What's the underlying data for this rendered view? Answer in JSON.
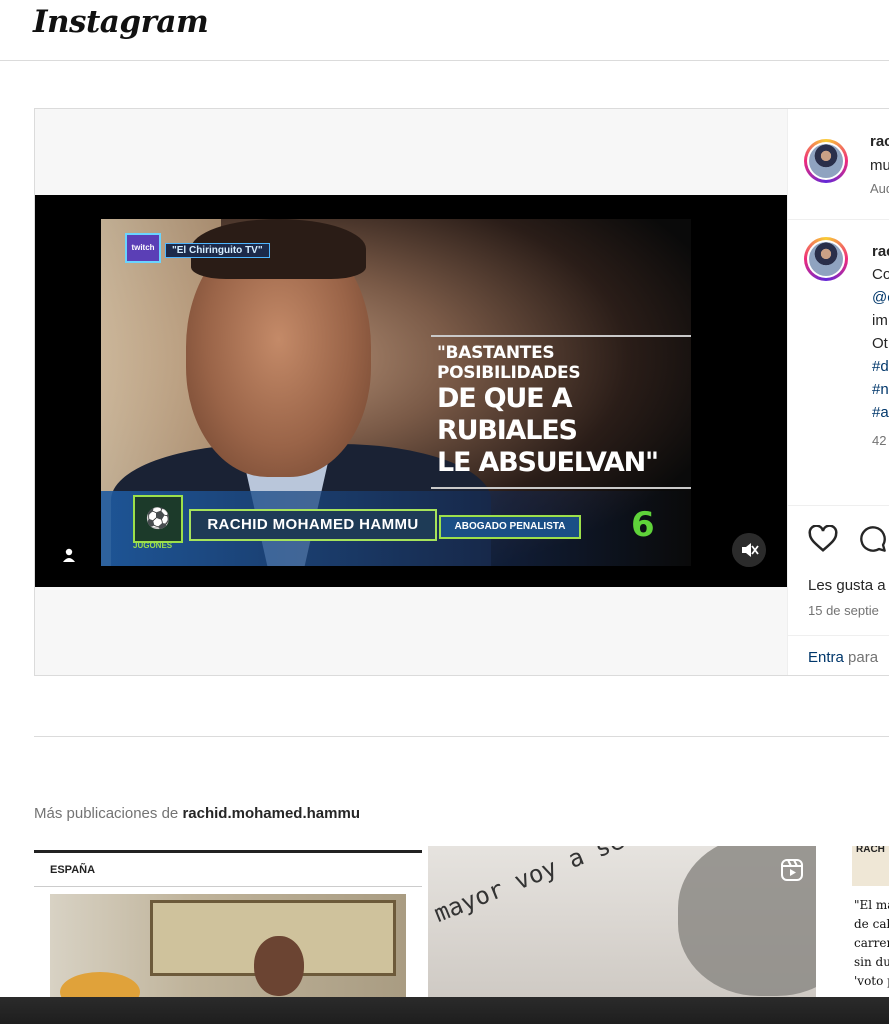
{
  "header": {
    "logo_text": "Instagram"
  },
  "post": {
    "video": {
      "source_tag": "\"El Chiringuito TV\"",
      "live_badge": "twitch",
      "quote_line1": "\"BASTANTES POSIBILIDADES",
      "quote_line2": "DE QUE A RUBIALES",
      "quote_line3": "LE ABSUELVAN\"",
      "channel_name": "JUGONES",
      "name_plate": "RACHID MOHAMED HAMMU",
      "role_plate": "ABOGADO PENALISTA",
      "network_logo": "6"
    },
    "sidebar": {
      "author_line1": "rac",
      "author_line2": "mu",
      "audio_label": "Aud",
      "caption_user": "rac",
      "caption_lines": [
        "Co",
        "@c",
        "im",
        "Ot"
      ],
      "hashtags": [
        "#d",
        "#n",
        "#a"
      ],
      "caption_meta": "42",
      "likes_text": "Les gusta a",
      "date_text": "15 de septie",
      "login_link": "Entra",
      "login_suffix": "para"
    }
  },
  "more": {
    "prefix": "Más publicaciones de",
    "username": "rachid.mohamed.hammu",
    "thumb1_section": "ESPAÑA",
    "thumb2_text": "mayor voy a ser",
    "thumb3_header": "RACH",
    "thumb3_lines": [
      "\"El ma",
      "de cab",
      "carrera",
      "sin dud",
      "'voto p"
    ]
  },
  "icons": {
    "like": "heart-icon",
    "comment": "comment-icon",
    "mute": "muted-speaker-icon",
    "user": "user-tag-icon",
    "reel": "reels-icon"
  },
  "colors": {
    "link": "#00376b",
    "muted": "#737373",
    "border": "#dbdbdb",
    "green_accent": "#9de04a"
  }
}
